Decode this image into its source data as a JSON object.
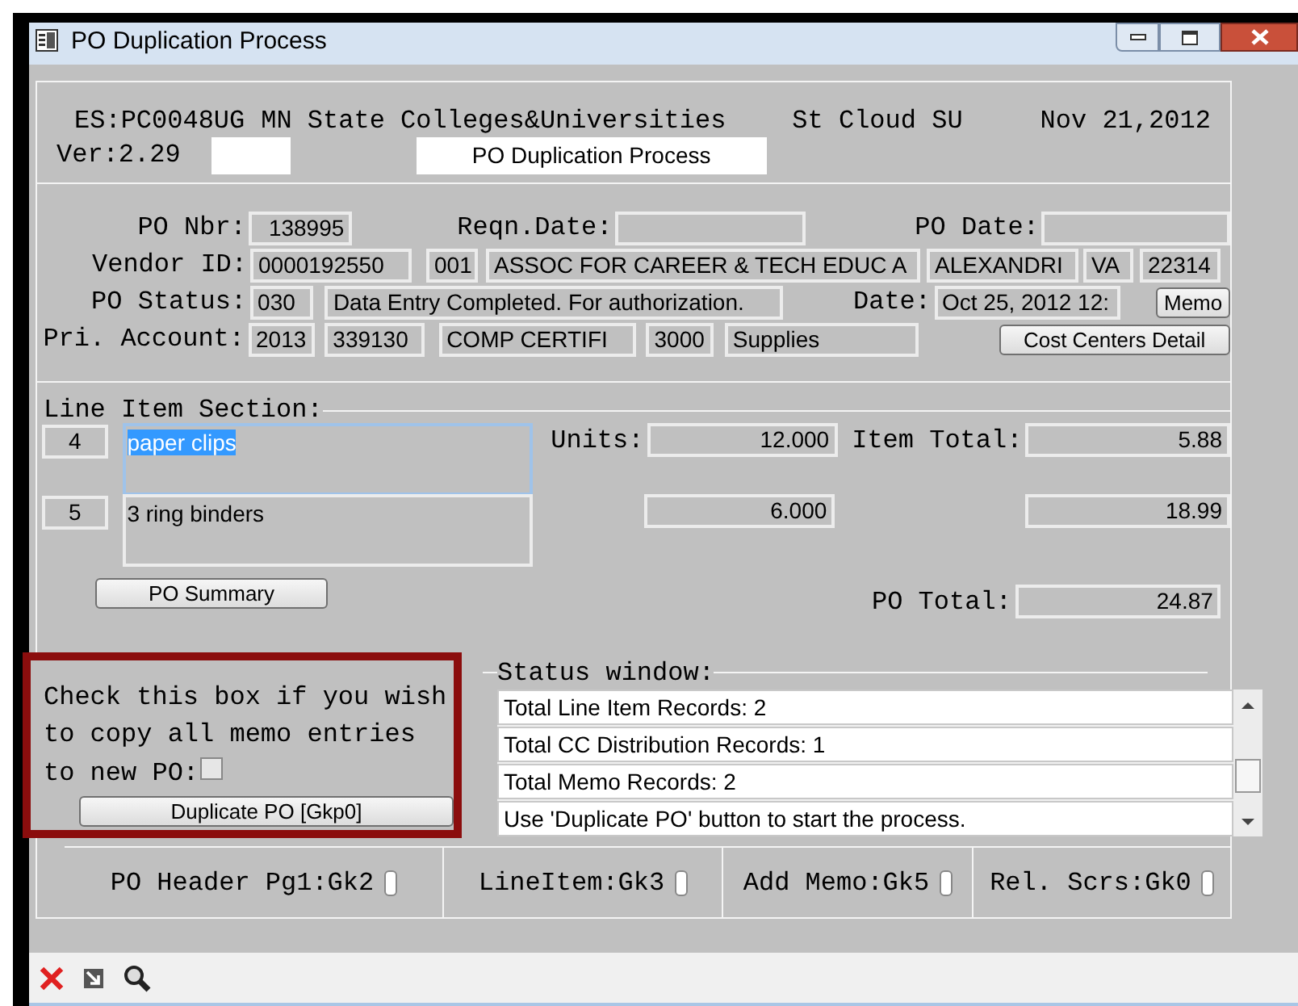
{
  "window": {
    "title": "PO Duplication Process"
  },
  "header": {
    "system_label": "ES:",
    "screen_id": "PC0048UG",
    "organization": "MN State Colleges&Universities",
    "campus": "St Cloud SU",
    "date": "Nov 21,2012",
    "version": "Ver:2.29",
    "screen_title": "PO Duplication Process"
  },
  "po": {
    "po_nbr_label": "PO Nbr:",
    "po_nbr": "138995",
    "reqn_date_label": "Reqn.Date:",
    "po_date_label": "PO Date:",
    "vendor_id_label": "Vendor ID:",
    "vendor_id": "0000192550",
    "vendor_suffix": "001",
    "vendor_name": "ASSOC FOR CAREER & TECH EDUC A",
    "vendor_city": "ALEXANDRI",
    "vendor_state": "VA",
    "vendor_zip": "22314",
    "po_status_label": "PO Status:",
    "po_status_code": "030",
    "po_status_text": "Data Entry Completed. For authorization.",
    "date_label": "Date:",
    "date": "Oct 25, 2012 12:",
    "memo_button": "Memo",
    "pri_account_label": "Pri. Account:",
    "account": [
      "2013",
      "339130",
      "COMP CERTIFI",
      "3000",
      "Supplies"
    ],
    "cost_centers_button": "Cost Centers Detail"
  },
  "line_items": {
    "title": "Line Item Section:",
    "units_label": "Units:",
    "item_total_label": "Item Total:",
    "rows": [
      {
        "number": "4",
        "description": "paper clips",
        "units": "12.000",
        "item_total": "5.88",
        "selected": true
      },
      {
        "number": "5",
        "description": "3 ring binders",
        "units": "6.000",
        "item_total": "18.99",
        "selected": false
      }
    ],
    "summary_button": "PO Summary",
    "po_total_label": "PO Total:",
    "po_total": "24.87"
  },
  "memo_copy": {
    "prompt": "Check this box if you wish to copy all memo entries",
    "checkbox_label": "to new PO:",
    "checked": false,
    "button": "Duplicate PO [Gkp0]"
  },
  "status_window": {
    "title": "Status window:",
    "lines": [
      "Total Line Item Records: 2",
      "Total CC Distribution Records: 1",
      "Total Memo Records: 2",
      "Use 'Duplicate PO' button to start the process."
    ]
  },
  "nav_keys": [
    "PO Header Pg1:Gk2",
    "LineItem:Gk3",
    "Add Memo:Gk5",
    "Rel. Scrs:Gk0"
  ]
}
